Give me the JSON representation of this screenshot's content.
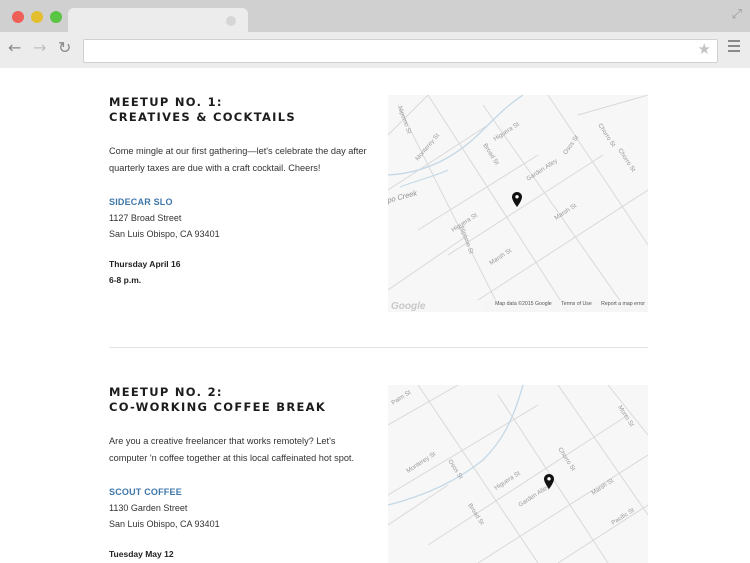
{
  "browser": {
    "url": "",
    "dots": [
      "#ed5f57",
      "#e3bf2f",
      "#5ac444"
    ],
    "back_icon": "back-arrow-icon",
    "forward_icon": "forward-arrow-icon",
    "reload_icon": "reload-icon",
    "star_icon": "bookmark-star-icon",
    "menu_icon": "hamburger-menu-icon"
  },
  "meetups": [
    {
      "title_line1": "MEETUP NO. 1:",
      "title_line2": "CREATIVES & COCKTAILS",
      "desc": "Come mingle at our first gathering—let's celebrate the day after quarterly taxes are due with a craft cocktail. Cheers!",
      "venue": "SIDECAR SLO",
      "address_line1": "1127 Broad Street",
      "address_line2": "San Luis Obispo, CA 93401",
      "date": "Thursday April 16",
      "time": "6-8 p.m.",
      "map": {
        "streets": [
          "Monterey St",
          "Higuera St",
          "Osos St",
          "Broad St",
          "Garden Alley",
          "Chorro St",
          "Marsh St",
          "Nipomo St",
          "Higuera St",
          "Nipomo St",
          "Marsh St",
          "Chorro St"
        ],
        "creek": "po Creek",
        "attribution": "Map data ©2015 Google",
        "terms": "Terms of Use",
        "report": "Report a map error",
        "logo": "Google"
      }
    },
    {
      "title_line1": "MEETUP NO. 2:",
      "title_line2": "CO-WORKING COFFEE BREAK",
      "desc": "Are you a creative freelancer that works remotely? Let's computer 'n coffee together at this local caffeinated  hot spot.",
      "venue": "SCOUT COFFEE",
      "address_line1": "1130 Garden Street",
      "address_line2": "San Luis Obispo, CA 93401",
      "date": "Tuesday May 12",
      "map": {
        "streets": [
          "Palm St",
          "Monterey St",
          "Osos St",
          "Higuera St",
          "Garden Alley",
          "Broad St",
          "Chorro St",
          "Morro St",
          "Marsh St",
          "Pacific St"
        ]
      }
    }
  ]
}
